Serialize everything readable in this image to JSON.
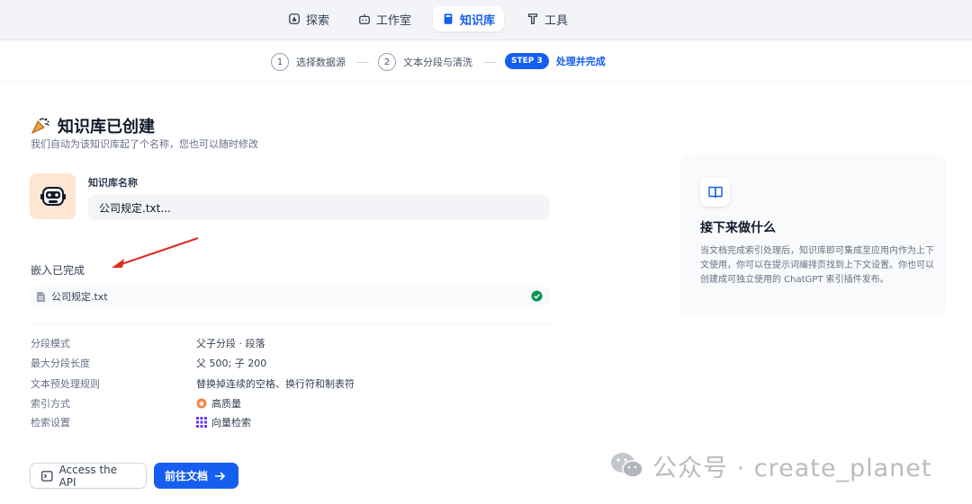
{
  "nav": {
    "items": [
      {
        "label": "探索",
        "icon": "compass-icon",
        "active": false
      },
      {
        "label": "工作室",
        "icon": "robot-icon",
        "active": false
      },
      {
        "label": "知识库",
        "icon": "book-icon",
        "active": true
      },
      {
        "label": "工具",
        "icon": "hammer-icon",
        "active": false
      }
    ]
  },
  "stepper": {
    "steps": [
      {
        "num": "1",
        "label": "选择数据源"
      },
      {
        "num": "2",
        "label": "文本分段与清洗"
      },
      {
        "badge": "STEP 3",
        "label": "处理并完成"
      }
    ]
  },
  "main": {
    "title": "知识库已创建",
    "title_icon": "party-popper-icon",
    "subtitle": "我们自动为该知识库起了个名称，您也可以随时修改",
    "name_label": "知识库名称",
    "name_value": "公司规定.txt...",
    "embed_title": "嵌入已完成",
    "file_name": "公司规定.txt",
    "settings": [
      {
        "key": "分段模式",
        "value": "父子分段 · 段落",
        "icon": ""
      },
      {
        "key": "最大分段长度",
        "value": "父 500; 子 200",
        "icon": ""
      },
      {
        "key": "文本预处理规则",
        "value": "替换掉连续的空格、换行符和制表符",
        "icon": ""
      },
      {
        "key": "索引方式",
        "value": "高质量",
        "icon": "high-quality-icon"
      },
      {
        "key": "检索设置",
        "value": "向量检索",
        "icon": "vector-search-icon"
      }
    ],
    "api_button": "Access the API",
    "doc_button": "前往文档"
  },
  "side_card": {
    "title": "接下来做什么",
    "text": "当文档完成索引处理后，知识库即可集成至应用内作为上下文使用，你可以在提示词编排页找到上下文设置。你也可以创建成可独立使用的 ChatGPT 索引插件发布。"
  },
  "watermark": "公众号 · create_planet",
  "colors": {
    "accent": "#155eef",
    "success": "#079455",
    "annotation_arrow": "#d92d20"
  }
}
